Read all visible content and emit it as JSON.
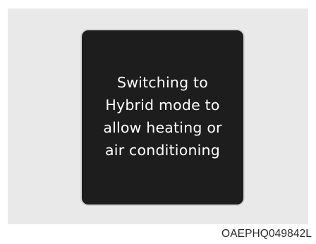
{
  "display": {
    "message": "Switching to\nHybrid mode to\nallow heating or\nair conditioning",
    "background_color": "#1d1d1d",
    "text_color": "#ffffff"
  },
  "figure": {
    "image_code": "OAEPHQ049842L",
    "panel_color": "#e9e9e9"
  }
}
